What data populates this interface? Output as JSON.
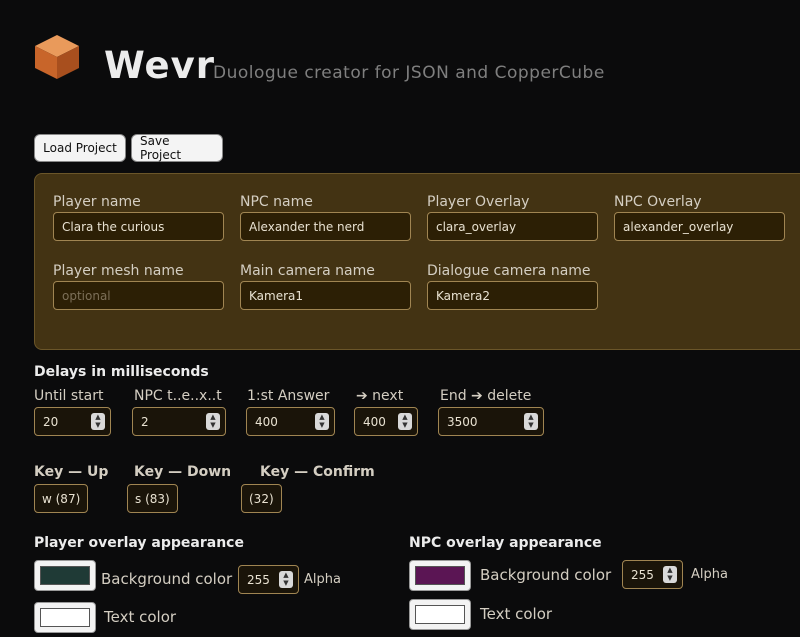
{
  "app": {
    "title": "Wevr",
    "subtitle": "Duologue creator for JSON and CopperCube"
  },
  "toolbar": {
    "load_label": "Load Project",
    "save_label": "Save Project"
  },
  "names": {
    "player_name": {
      "label": "Player name",
      "value": "Clara the curious"
    },
    "npc_name": {
      "label": "NPC name",
      "value": "Alexander the nerd"
    },
    "player_overlay": {
      "label": "Player Overlay",
      "value": "clara_overlay"
    },
    "npc_overlay": {
      "label": "NPC Overlay",
      "value": "alexander_overlay"
    },
    "player_mesh": {
      "label": "Player mesh name",
      "value": "",
      "placeholder": "optional"
    },
    "main_camera": {
      "label": "Main camera name",
      "value": "Kamera1"
    },
    "dialogue_camera": {
      "label": "Dialogue camera name",
      "value": "Kamera2"
    }
  },
  "delays": {
    "heading": "Delays in milliseconds",
    "until_start": {
      "label": "Until start",
      "value": "20"
    },
    "npc_text": {
      "label": "NPC t..e..x..t",
      "value": "2"
    },
    "first_answer": {
      "label": "1:st Answer",
      "value": "400"
    },
    "next": {
      "label": "➔ next",
      "value": "400"
    },
    "end_delete": {
      "label": "End ➔ delete",
      "value": "3500"
    }
  },
  "keys": {
    "up": {
      "label": "Key — Up",
      "value": "w (87)"
    },
    "down": {
      "label": "Key — Down",
      "value": "s (83)"
    },
    "confirm": {
      "label": "Key — Confirm",
      "value": "(32)"
    }
  },
  "player_overlay_appearance": {
    "heading": "Player overlay appearance",
    "background_label": "Background color",
    "background_color": "#1f3a36",
    "alpha_value": "255",
    "alpha_label": "Alpha",
    "text_label": "Text color",
    "text_color": "#ffffff"
  },
  "npc_overlay_appearance": {
    "heading": "NPC overlay appearance",
    "background_label": "Background color",
    "background_color": "#5b1554",
    "alpha_value": "255",
    "alpha_label": "Alpha",
    "text_label": "Text color",
    "text_color": "#ffffff"
  },
  "icons": {
    "logo": "orange-cube-icon",
    "spinner": "spinner-arrows-icon"
  },
  "colors": {
    "accent": "#d77a38",
    "panel": "#433313"
  }
}
